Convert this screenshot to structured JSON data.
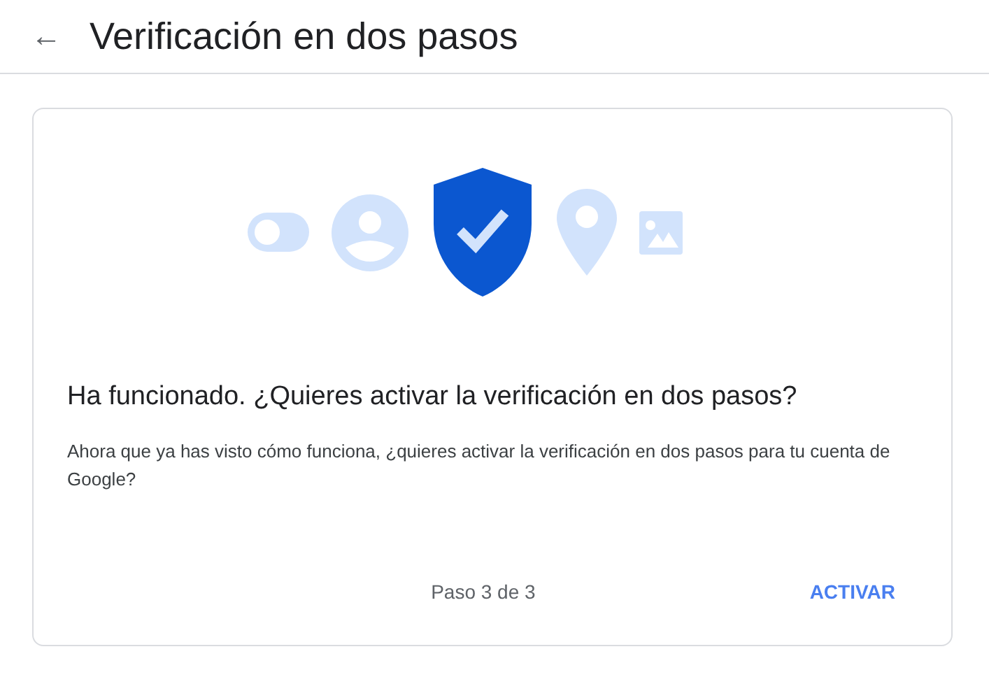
{
  "header": {
    "back": "←",
    "title": "Verificación en dos pasos"
  },
  "card": {
    "heading": "Ha funcionado. ¿Quieres activar la verificación en dos pasos?",
    "body": "Ahora que ya has visto cómo funciona, ¿quieres activar la verificación en dos pasos para tu cuenta de Google?",
    "step": "Paso 3 de 3",
    "action": "ACTIVAR"
  }
}
